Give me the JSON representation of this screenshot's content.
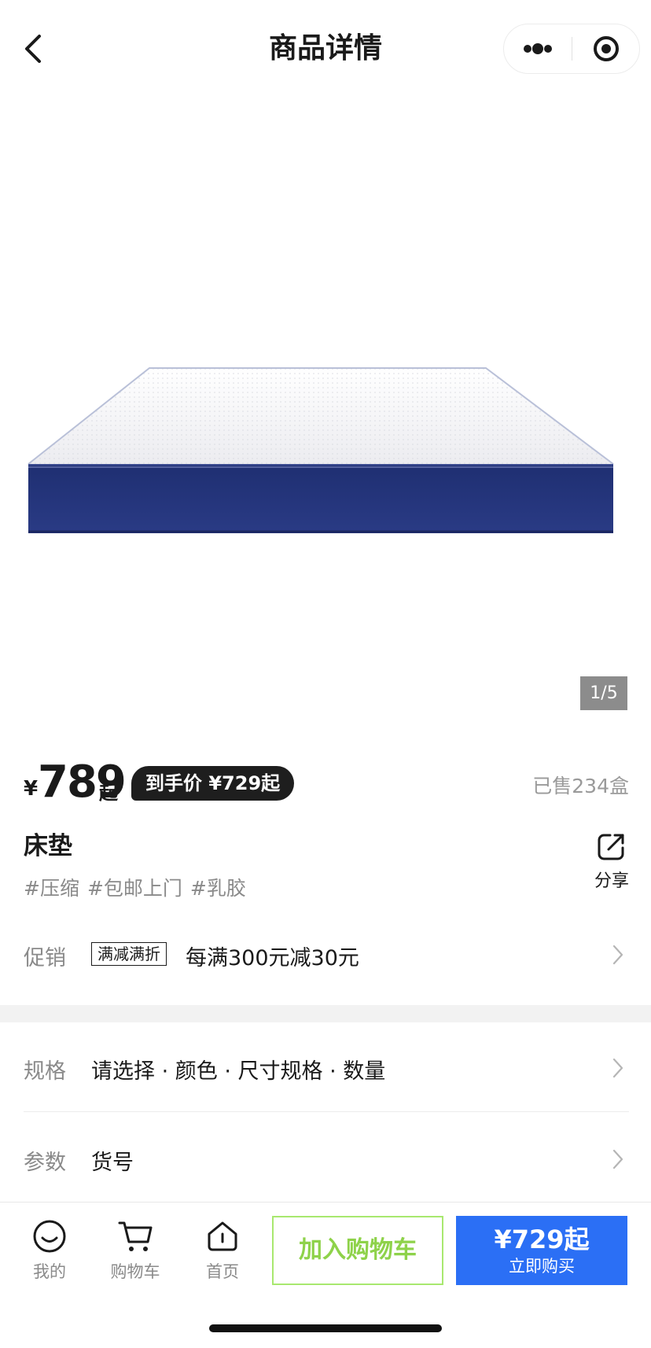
{
  "header": {
    "title": "商品详情"
  },
  "gallery": {
    "page_indicator": "1/5",
    "image_subject": "mattress"
  },
  "price": {
    "currency": "¥",
    "amount": "789",
    "suffix": "起",
    "final_price_badge": "到手价 ¥729起",
    "sold": "已售234盒"
  },
  "product": {
    "title": "床垫",
    "tags": [
      "#压缩",
      "#包邮上门",
      "#乳胶"
    ],
    "share_label": "分享"
  },
  "promo": {
    "label": "促销",
    "tag": "满减满折",
    "text": "每满300元减30元"
  },
  "spec": {
    "label": "规格",
    "value": "请选择 · 颜色 · 尺寸规格 · 数量"
  },
  "params": {
    "label": "参数",
    "value": "货号"
  },
  "bottom_bar": {
    "nav": [
      {
        "label": "我的",
        "icon": "smile-icon"
      },
      {
        "label": "购物车",
        "icon": "cart-icon"
      },
      {
        "label": "首页",
        "icon": "home-icon"
      }
    ],
    "add_to_cart": "加入购物车",
    "buy_price": "¥729起",
    "buy_label": "立即购买"
  },
  "colors": {
    "buy_button": "#2b6ff5",
    "add_cart_accent": "#8ed24a",
    "mattress_base": "#24357a"
  }
}
